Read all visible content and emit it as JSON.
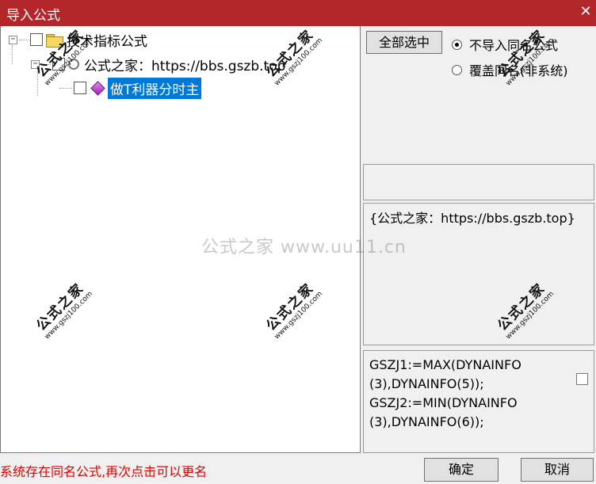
{
  "window": {
    "title": "导入公式",
    "close_glyph": "✕"
  },
  "tree": {
    "root": {
      "expander": "−",
      "label": "技术指标公式",
      "icon": "folder-icon"
    },
    "group": {
      "expander": "−",
      "label": "公式之家：https://bbs.gszb.top",
      "icon": "gear-icon"
    },
    "item": {
      "label": "做T利器分时主",
      "icon": "formula-gem-icon"
    }
  },
  "options": {
    "select_all_label": "全部选中",
    "radio_skip_label": "不导入同名公式",
    "radio_overwrite_label": "覆盖同名(非系统)"
  },
  "info": {
    "text": "{公式之家：https://bbs.gszb.top}"
  },
  "code": {
    "line1": "GSZJ1:=MAX(DYNAINFO",
    "line2": "(3),DYNAINFO(5));",
    "line3": "GSZJ2:=MIN(DYNAINFO",
    "line4": "(3),DYNAINFO(6));"
  },
  "status": {
    "message": "系统存在同名公式,再次点击可以更名"
  },
  "buttons": {
    "ok_label": "确定",
    "cancel_label": "取消"
  },
  "watermarks": {
    "center_text": "公式之家 www.uu11.cn",
    "stamp_title": "公式之家",
    "stamp_url": "www.gszj100.com"
  },
  "colors": {
    "titlebar": "#b3272b",
    "selection": "#0078d7",
    "status_text": "#e00000"
  }
}
